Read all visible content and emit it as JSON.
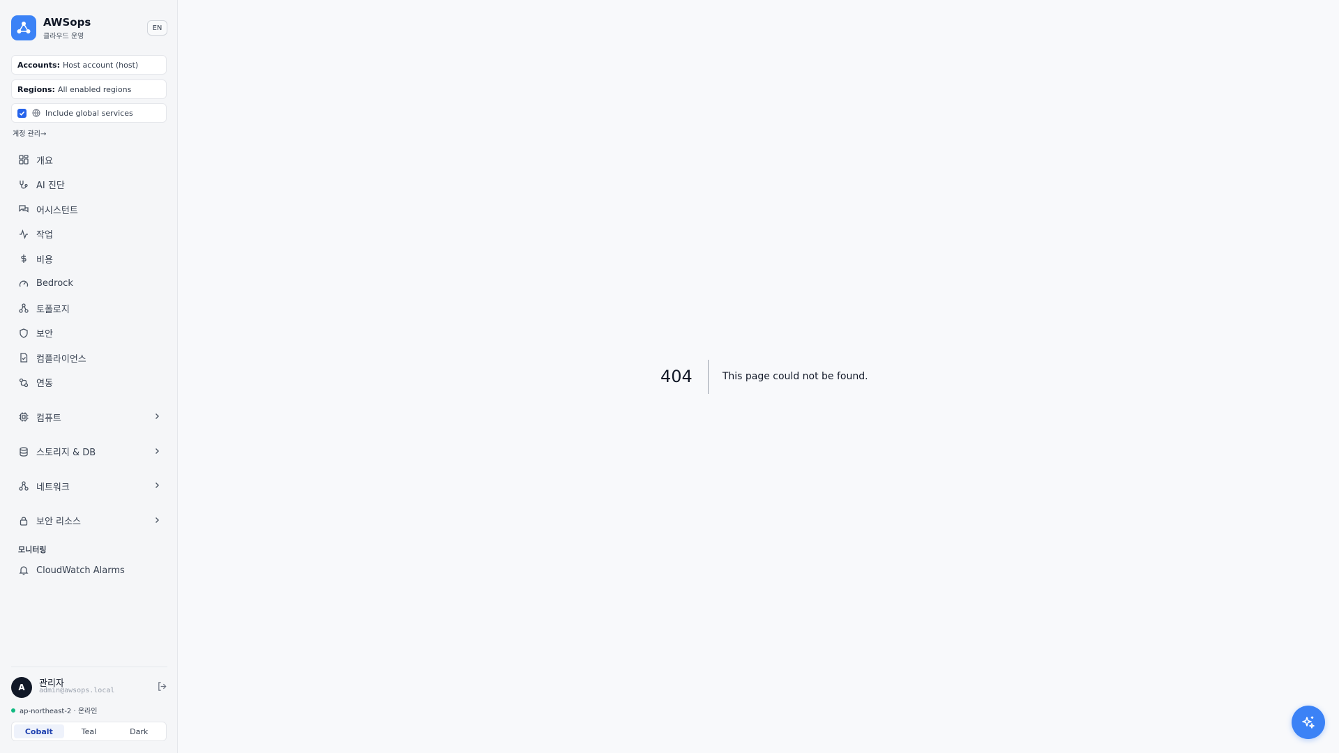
{
  "brand": {
    "name": "AWSops",
    "subtitle": "클라우드 운영",
    "lang_button": "EN"
  },
  "selectors": {
    "accounts_label": "Accounts:",
    "accounts_value": "Host account (host)",
    "regions_label": "Regions:",
    "regions_value": "All enabled regions",
    "global_label": "Include global services",
    "global_checked": true
  },
  "account_mgmt": "계정 관리→",
  "nav": {
    "items": [
      {
        "label": "개요",
        "icon": "grid-icon"
      },
      {
        "label": "AI 진단",
        "icon": "stethoscope-icon"
      },
      {
        "label": "어시스턴트",
        "icon": "chat-icon"
      },
      {
        "label": "작업",
        "icon": "activity-icon"
      },
      {
        "label": "비용",
        "icon": "dollar-icon"
      },
      {
        "label": "Bedrock",
        "icon": "gauge-icon"
      },
      {
        "label": "토폴로지",
        "icon": "network-icon"
      },
      {
        "label": "보안",
        "icon": "shield-icon"
      },
      {
        "label": "컴플라이언스",
        "icon": "document-check-icon"
      },
      {
        "label": "연동",
        "icon": "link-icon"
      }
    ],
    "groups": [
      {
        "label": "컴퓨트",
        "icon": "cpu-icon"
      },
      {
        "label": "스토리지 & DB",
        "icon": "database-icon"
      },
      {
        "label": "네트워크",
        "icon": "network-icon"
      },
      {
        "label": "보안 리소스",
        "icon": "lock-icon"
      }
    ],
    "monitoring_label": "모니터링",
    "monitoring_items": [
      {
        "label": "CloudWatch Alarms",
        "icon": "bell-icon"
      }
    ]
  },
  "user": {
    "initial": "A",
    "name": "관리자",
    "email": "admin@awsops.local",
    "status": "ap-northeast-2 · 온라인",
    "status_color": "#10b981"
  },
  "themes": {
    "options": [
      "Cobalt",
      "Teal",
      "Dark"
    ],
    "active": "Cobalt"
  },
  "main": {
    "error_code": "404",
    "error_message": "This page could not be found."
  },
  "colors": {
    "accent": "#3b82f6",
    "active_theme_bg": "#eef2fb"
  }
}
